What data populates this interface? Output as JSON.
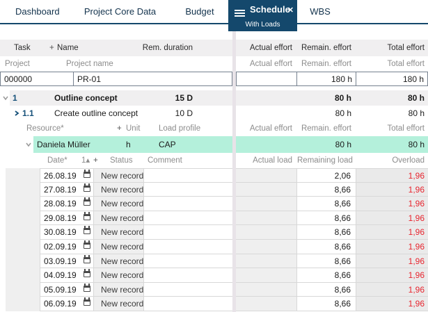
{
  "icons": {
    "close": "✕",
    "sort_asc": "▴",
    "add": "+"
  },
  "colors": {
    "accent_navy": "#14486C",
    "highlight_green": "#B4F0DB",
    "overload_red": "#E8242E",
    "row_gray": "#F0EFF0",
    "cell_gray": "#EFEFEF"
  },
  "tabs": [
    {
      "label": "Dashboard"
    },
    {
      "label": "Project Core Data"
    },
    {
      "label": "Budget"
    },
    {
      "label": "Schedule",
      "sub_label": "With Loads"
    },
    {
      "label": "WBS"
    }
  ],
  "task_table": {
    "header": {
      "task": "Task",
      "add": "+",
      "name": "Name",
      "rem_duration": "Rem. duration",
      "actual_effort": "Actual effort",
      "remain_effort": "Remain. effort",
      "total_effort": "Total effort"
    },
    "subheader": {
      "project": "Project",
      "project_name": "Project name",
      "actual_effort": "Actual effort",
      "remain_effort": "Remain. effort",
      "total_effort": "Total effort"
    },
    "project_row": {
      "id": "000000",
      "name": "PR-01",
      "actual_effort": "",
      "remain_effort": "180 h",
      "total_effort": "180 h"
    },
    "tasks": [
      {
        "wbs": "1",
        "name": "Outline concept",
        "rem_duration": "15 D",
        "actual_effort": "",
        "remain_effort": "80 h",
        "total_effort": "80 h"
      },
      {
        "wbs": "1.1",
        "name": "Create outline concept",
        "rem_duration": "10 D",
        "actual_effort": "",
        "remain_effort": "80 h",
        "total_effort": "80 h"
      }
    ]
  },
  "resource": {
    "header": {
      "resource": "Resource*",
      "add": "+",
      "unit": "Unit",
      "load_profile": "Load profile",
      "actual_effort": "Actual effort",
      "remain_effort": "Remain. effort",
      "total_effort": "Total effort"
    },
    "row": {
      "name": "Daniela Müller",
      "unit": "h",
      "load_profile": "CAP",
      "actual_effort": "",
      "remain_effort": "80 h",
      "total_effort": "80 h"
    }
  },
  "load_table": {
    "header": {
      "date": "Date*",
      "sort_key": "1",
      "add": "+",
      "status": "Status",
      "comment": "Comment",
      "actual_load": "Actual load",
      "remaining_load": "Remaining load",
      "overload": "Overload"
    },
    "rows": [
      {
        "date": "26.08.19",
        "status": "New record",
        "comment": "",
        "actual_load": "",
        "remaining_load": "2,06",
        "overload": "1,96"
      },
      {
        "date": "27.08.19",
        "status": "New record",
        "comment": "",
        "actual_load": "",
        "remaining_load": "8,66",
        "overload": "1,96"
      },
      {
        "date": "28.08.19",
        "status": "New record",
        "comment": "",
        "actual_load": "",
        "remaining_load": "8,66",
        "overload": "1,96"
      },
      {
        "date": "29.08.19",
        "status": "New record",
        "comment": "",
        "actual_load": "",
        "remaining_load": "8,66",
        "overload": "1,96"
      },
      {
        "date": "30.08.19",
        "status": "New record",
        "comment": "",
        "actual_load": "",
        "remaining_load": "8,66",
        "overload": "1,96"
      },
      {
        "date": "02.09.19",
        "status": "New record",
        "comment": "",
        "actual_load": "",
        "remaining_load": "8,66",
        "overload": "1,96"
      },
      {
        "date": "03.09.19",
        "status": "New record",
        "comment": "",
        "actual_load": "",
        "remaining_load": "8,66",
        "overload": "1,96"
      },
      {
        "date": "04.09.19",
        "status": "New record",
        "comment": "",
        "actual_load": "",
        "remaining_load": "8,66",
        "overload": "1,96"
      },
      {
        "date": "05.09.19",
        "status": "New record",
        "comment": "",
        "actual_load": "",
        "remaining_load": "8,66",
        "overload": "1,96"
      },
      {
        "date": "06.09.19",
        "status": "New record",
        "comment": "",
        "actual_load": "",
        "remaining_load": "8,66",
        "overload": "1,96"
      }
    ]
  }
}
